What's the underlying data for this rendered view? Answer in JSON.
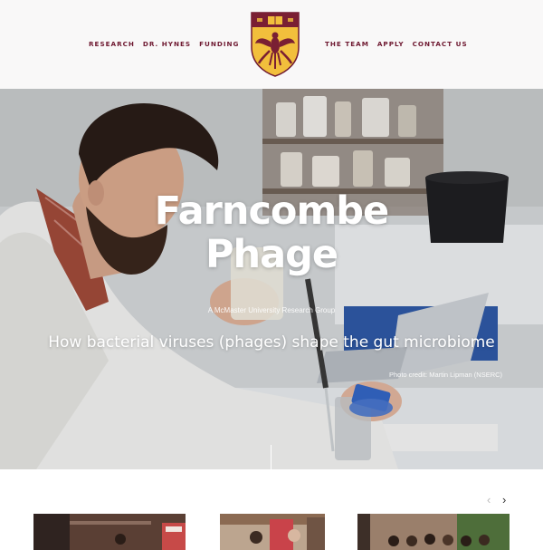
{
  "nav": {
    "left": [
      "RESEARCH",
      "DR. HYNES",
      "FUNDING"
    ],
    "right": [
      "THE TEAM",
      "APPLY",
      "CONTACT US"
    ]
  },
  "logo": {
    "icon": "university-crest-icon"
  },
  "hero": {
    "title_line1": "Farncombe",
    "title_line2": "Phage",
    "subtitle": "A McMaster University Research Group",
    "tagline": "How bacterial viruses (phages) shape the gut microbiome",
    "photo_credit": "Photo credit: Martin Lipman (NSERC)"
  },
  "carousel": {
    "prev_icon": "chevron-left-icon",
    "next_icon": "chevron-right-icon",
    "prev_symbol": "‹",
    "next_symbol": "›"
  },
  "colors": {
    "accent": "#6e1830",
    "crest_gold": "#f2bf3c",
    "crest_maroon": "#7a1f33",
    "header_bg": "#f9f8f8"
  }
}
